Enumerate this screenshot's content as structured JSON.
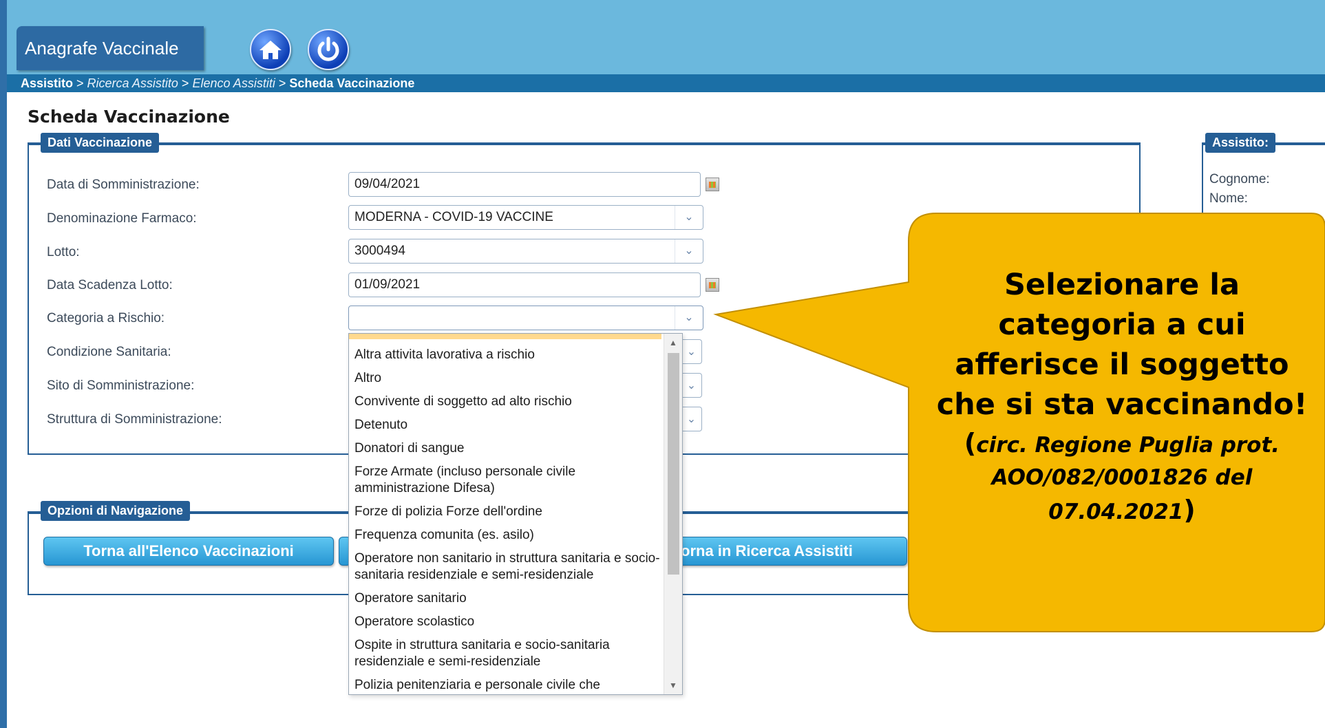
{
  "app": {
    "title": "Anagrafe Vaccinale"
  },
  "breadcrumb": {
    "root": "Assistito",
    "sep": " > ",
    "step1": "Ricerca Assistito",
    "step2": "Elenco Assistiti",
    "current": "Scheda Vaccinazione"
  },
  "page_title": "Scheda Vaccinazione",
  "dati_vaccinazione": {
    "legend": "Dati Vaccinazione",
    "fields": {
      "data_somministrazione": {
        "label": "Data di Somministrazione:",
        "value": "09/04/2021"
      },
      "denominazione_farmaco": {
        "label": "Denominazione Farmaco:",
        "value": "MODERNA - COVID-19 VACCINE"
      },
      "lotto": {
        "label": "Lotto:",
        "value": "3000494"
      },
      "data_scadenza_lotto": {
        "label": "Data Scadenza Lotto:",
        "value": "01/09/2021"
      },
      "categoria_rischio": {
        "label": "Categoria a Rischio:",
        "value": ""
      },
      "condizione_sanitaria": {
        "label": "Condizione Sanitaria:"
      },
      "sito_somministrazione": {
        "label": "Sito di Somministrazione:"
      },
      "struttura_somministrazione": {
        "label": "Struttura di Somministrazione:"
      }
    }
  },
  "categoria_dropdown": {
    "options": [
      "Altra attivita lavorativa a rischio",
      "Altro",
      "Convivente di soggetto ad alto rischio",
      "Detenuto",
      "Donatori di sangue",
      "Forze Armate (incluso personale civile amministrazione Difesa)",
      "Forze di polizia Forze dell'ordine",
      "Frequenza comunita (es. asilo)",
      "Operatore non sanitario in struttura sanitaria e socio-sanitaria residenziale e semi-residenziale",
      "Operatore sanitario",
      "Operatore scolastico",
      "Ospite in struttura sanitaria e socio-sanitaria residenziale e semi-residenziale",
      "Polizia penitenziaria e personale civile che"
    ]
  },
  "navigation": {
    "legend": "Opzioni di Navigazione",
    "btn_elenco": "Torna all'Elenco Vaccinazioni",
    "btn_ricerca": "orna in Ricerca Assistiti"
  },
  "assistito": {
    "legend": "Assistito:",
    "cognome_label": "Cognome:",
    "nome_label": "Nome:"
  },
  "callout": {
    "main": "Selezionare la categoria a cui afferisce il soggetto che si sta vaccinando!",
    "ref_open": "(",
    "ref": "circ. Regione Puglia prot. AOO/082/0001826 del 07.04.2021",
    "ref_close": ")",
    "color": "#f5b800"
  },
  "icons": [
    "home-icon",
    "power-icon",
    "calendar-icon",
    "chevron-down-icon"
  ]
}
